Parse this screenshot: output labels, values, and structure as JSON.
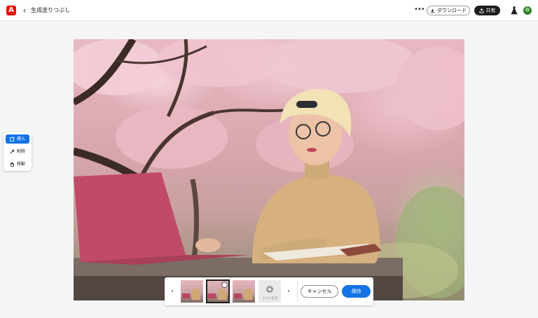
{
  "header": {
    "title": "生成塗りつぶし",
    "download_label": "ダウンロード",
    "share_label": "共有",
    "logo_letter": "A"
  },
  "tools": [
    {
      "label": "挿入",
      "icon": "insert-icon",
      "active": true
    },
    {
      "label": "削除",
      "icon": "remove-icon",
      "active": false
    },
    {
      "label": "移動",
      "icon": "hand-icon",
      "active": false
    }
  ],
  "variations": {
    "count": 3,
    "selected_index": 1,
    "add_label": "さらに生成"
  },
  "actions": {
    "cancel_label": "キャンセル",
    "keep_label": "保持"
  },
  "colors": {
    "accent": "#1473e6",
    "brand": "#eb1000",
    "share_bg": "#1d1d1d"
  }
}
